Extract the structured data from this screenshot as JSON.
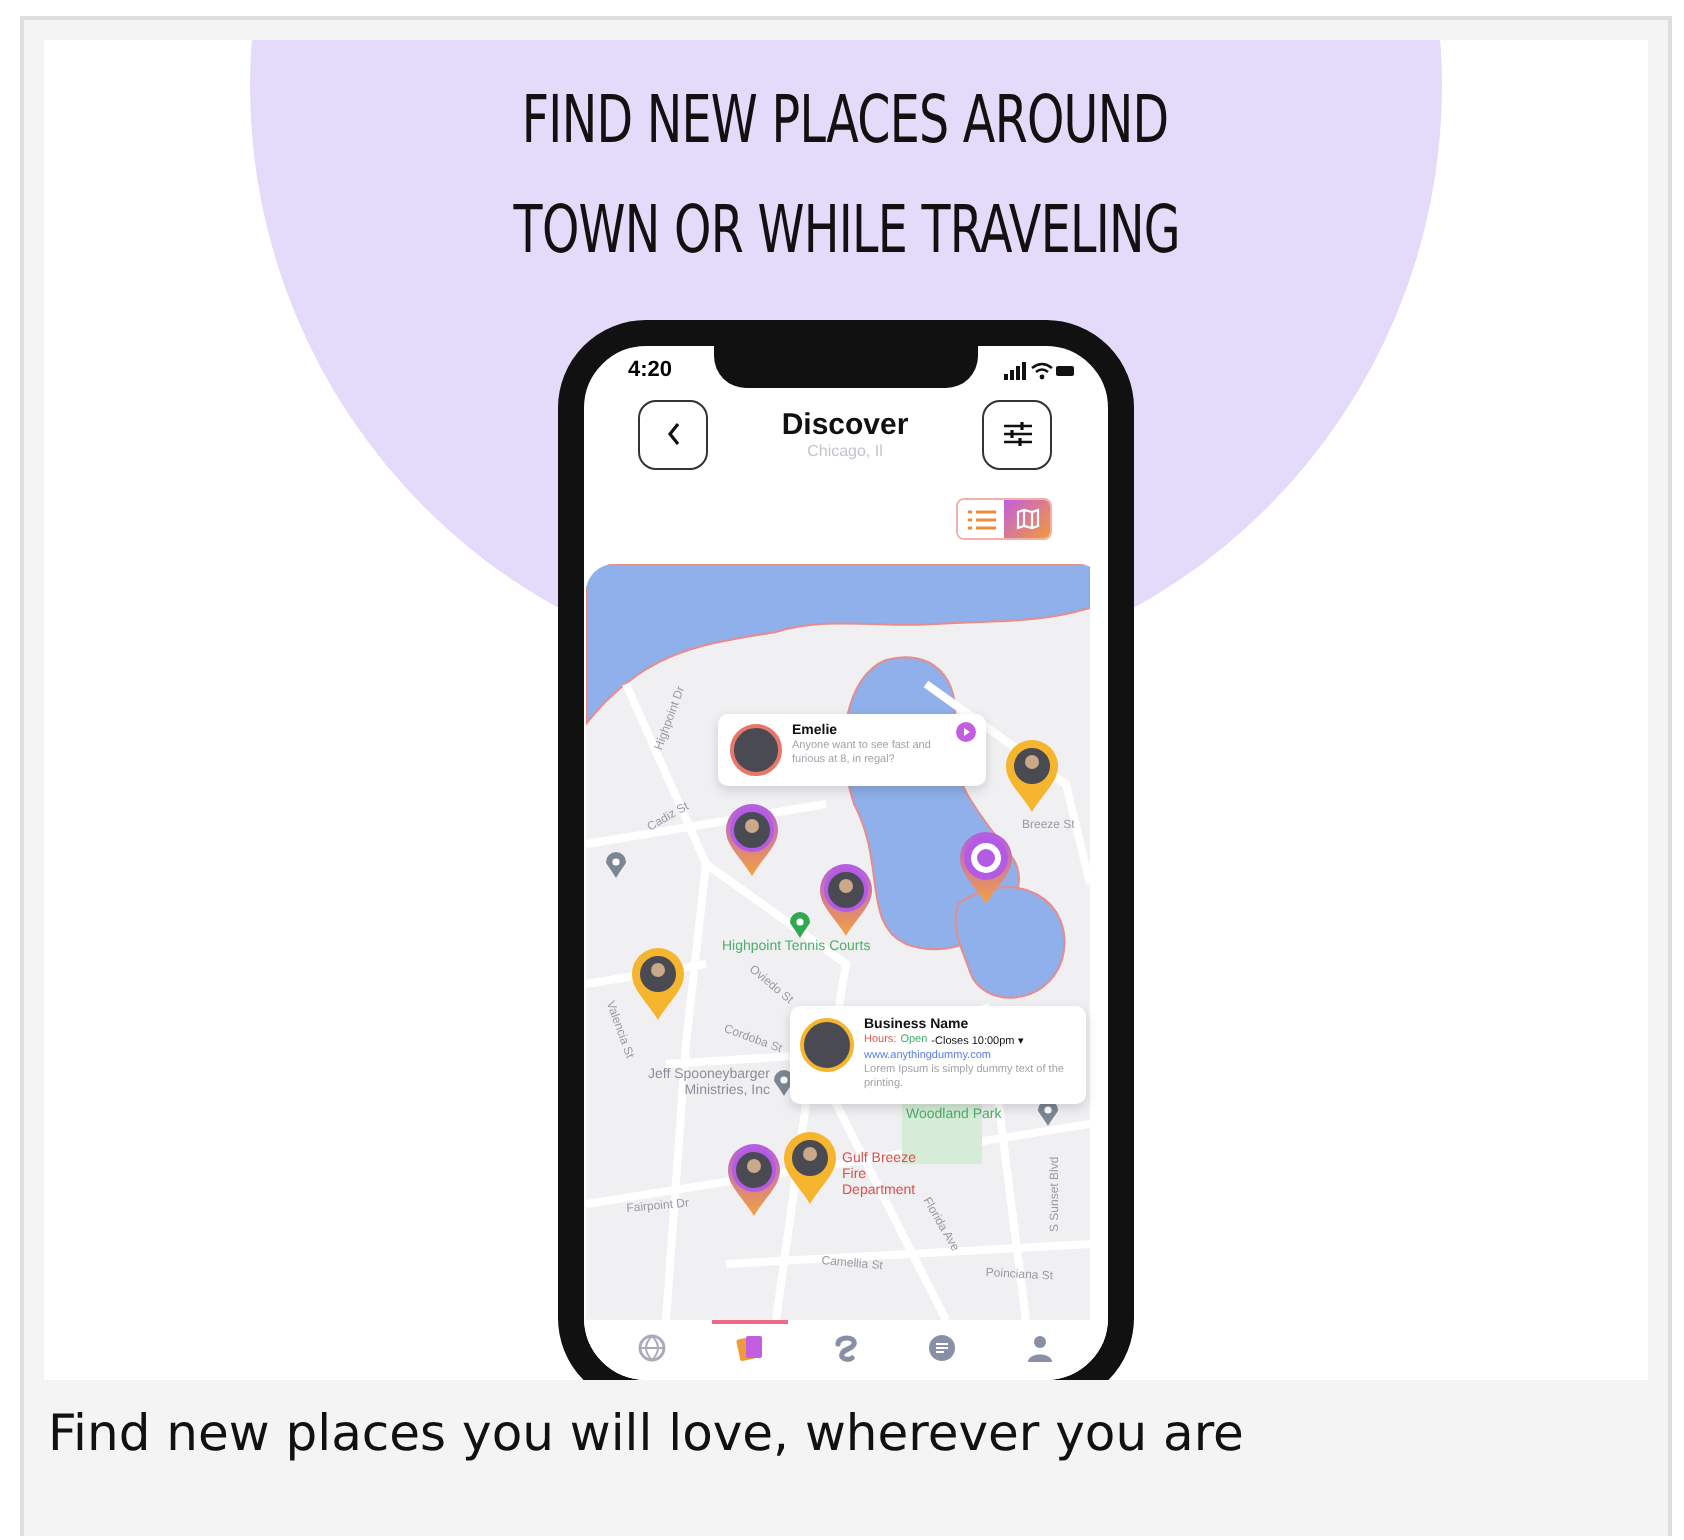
{
  "headline": {
    "lines": [
      "FIND NEW PLACES AROUND",
      "TOWN OR WHILE TRAVELING"
    ]
  },
  "phone": {
    "status_bar": {
      "time": "4:20"
    },
    "header": {
      "title": "Discover",
      "subtitle": "Chicago, Il"
    },
    "view_toggle": [
      {
        "kind": "list",
        "selected": false
      },
      {
        "kind": "map",
        "selected": true
      }
    ],
    "map": {
      "labels": [
        {
          "text": "Highpoint Dr",
          "kind": "street"
        },
        {
          "text": "Cadiz St",
          "kind": "street"
        },
        {
          "text": "Breeze St",
          "kind": "street"
        },
        {
          "text": "Highpoint Tennis Courts",
          "kind": "park"
        },
        {
          "text": "Oviedo St",
          "kind": "street"
        },
        {
          "text": "Valencia St",
          "kind": "street"
        },
        {
          "text": "Cordoba St",
          "kind": "street"
        },
        {
          "text": "Jeff Spooneybarger Ministries, Inc",
          "kind": "business"
        },
        {
          "text": "Woodland Park",
          "kind": "park"
        },
        {
          "text": "Gulf Breeze Fire Department",
          "kind": "fire"
        },
        {
          "text": "Fairpoint Dr",
          "kind": "street"
        },
        {
          "text": "Camellia St",
          "kind": "street"
        },
        {
          "text": "Florida Ave",
          "kind": "street"
        },
        {
          "text": "S Sunset Blvd",
          "kind": "street"
        },
        {
          "text": "Poinciana St",
          "kind": "street"
        }
      ],
      "pins": [
        {
          "kind": "photo",
          "color": "#b45be6"
        },
        {
          "kind": "photo",
          "color": "#f5b52e"
        },
        {
          "kind": "dot",
          "color": "#b45be6"
        },
        {
          "kind": "photo",
          "color": "#b45be6"
        },
        {
          "kind": "photo",
          "color": "#f5b52e"
        },
        {
          "kind": "photo",
          "color": "#b45be6"
        },
        {
          "kind": "photo",
          "color": "#f5b52e"
        }
      ],
      "post_popup": {
        "name": "Emelie",
        "message": "Anyone want to see fast and furious at 8, in regal?"
      },
      "business_popup": {
        "name": "Business Name",
        "hours_label": "Hours:",
        "status": "Open",
        "closes": "-Closes 10:00pm ▾",
        "website": "www.anythingdummy.com",
        "description": "Lorem Ipsum is simply dummy text of the printing."
      }
    },
    "bottom_nav": [
      {
        "kind": "explore",
        "selected": false
      },
      {
        "kind": "cards",
        "selected": true
      },
      {
        "kind": "help",
        "selected": false
      },
      {
        "kind": "chat",
        "selected": false
      },
      {
        "kind": "profile",
        "selected": false
      }
    ]
  },
  "caption": "Find new places you will love, wherever you are"
}
